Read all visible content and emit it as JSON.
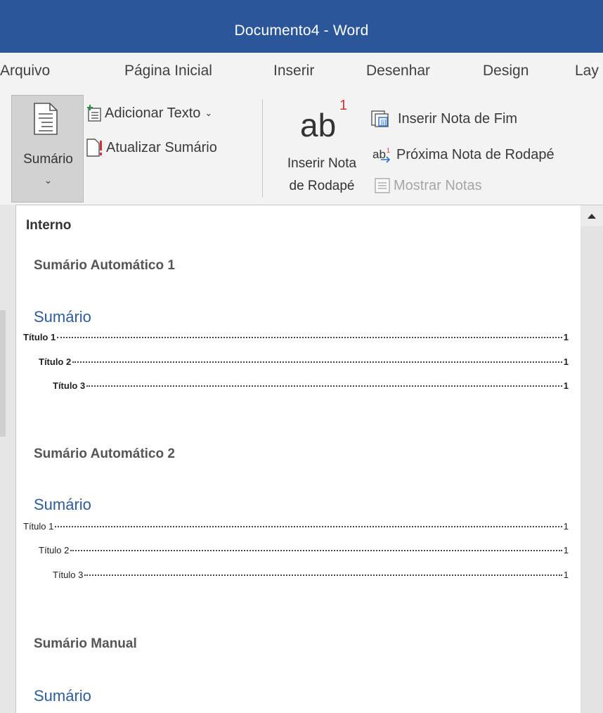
{
  "window": {
    "title": "Documento4  -  Word"
  },
  "tabs": [
    "Arquivo",
    "Página Inicial",
    "Inserir",
    "Desenhar",
    "Design",
    "Lay"
  ],
  "ribbon": {
    "toc_button_label": "Sumário",
    "add_text_label": "Adicionar Texto",
    "update_toc_label": "Atualizar Sumário",
    "footnote_big_glyph": "ab",
    "footnote_superscript": "1",
    "footnote_label_line1": "Inserir Nota",
    "footnote_label_line2": "de Rodapé",
    "endnote_label": "Inserir Nota de Fim",
    "next_footnote_label": "Próxima Nota de Rodapé",
    "show_notes_label": "Mostrar Notas"
  },
  "gallery": {
    "section_header": "Interno",
    "items": [
      {
        "title": "Sumário Automático 1",
        "heading": "Sumário",
        "entries": [
          {
            "text": "Título 1",
            "page": "1"
          },
          {
            "text": "Título 2",
            "page": "1"
          },
          {
            "text": "Título 3",
            "page": "1"
          }
        ]
      },
      {
        "title": "Sumário Automático 2",
        "heading": "Sumário",
        "entries": [
          {
            "text": "Título 1",
            "page": "1"
          },
          {
            "text": "Título 2",
            "page": "1"
          },
          {
            "text": "Título 3",
            "page": "1"
          }
        ]
      },
      {
        "title": "Sumário Manual",
        "heading": "Sumário"
      }
    ]
  },
  "icons": [
    "document-toc-icon",
    "add-text-icon",
    "update-toc-icon",
    "endnote-icon",
    "next-footnote-icon",
    "show-notes-icon",
    "scroll-up-arrow-icon"
  ],
  "colors": {
    "title_bar": "#2b579a",
    "ribbon": "#f3f3f3",
    "toc_heading": "#2e5c9a",
    "selected_button": "#d2d2d2"
  }
}
